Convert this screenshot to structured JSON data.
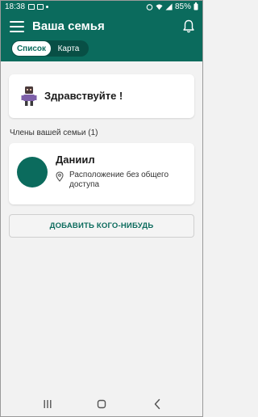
{
  "status_bar": {
    "time": "18:38",
    "battery": "85%"
  },
  "app_bar": {
    "title": "Ваша семья",
    "tabs": [
      {
        "label": "Список",
        "active": true
      },
      {
        "label": "Карта",
        "active": false
      }
    ]
  },
  "welcome": {
    "text": "Здравствуйте !"
  },
  "members_section": {
    "title": "Члены вашей семьи (1)",
    "members": [
      {
        "name": "Даниил",
        "location": "Расположение без общего доступа"
      }
    ]
  },
  "add_button": {
    "label": "ДОБАВИТЬ КОГО-НИБУДЬ"
  },
  "colors": {
    "primary": "#0b6b5d",
    "primary_dark": "#084f45",
    "background": "#f2f2f2"
  },
  "icons": [
    "menu-icon",
    "bell-icon",
    "robot-icon",
    "location-pin-icon",
    "recents-icon",
    "home-icon",
    "back-icon"
  ]
}
